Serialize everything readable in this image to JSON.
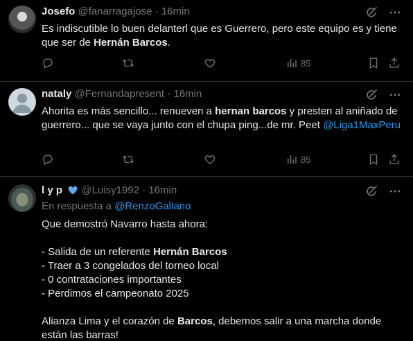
{
  "tweets": [
    {
      "name": "Josefo",
      "handle": "@fanarragajose",
      "time": "16min",
      "text_pre": "Es indiscutible lo buen delanterl que es Guerrero, pero este equipo es y tiene que ser de ",
      "text_bold": "Hernán Barcos",
      "text_post": ".",
      "views": "85"
    },
    {
      "name": "nataly",
      "handle": "@Fernandapresent",
      "time": "16min",
      "text_pre": "Ahorita es más sencillo... renueven a ",
      "text_bold": "hernan barcos",
      "text_post": " y presten al aniñado de guerrero... que se vaya junto con el chupa ping...de mr. Peet ",
      "mention": "@Liga1MaxPeru",
      "views": "85"
    },
    {
      "name": "l y p",
      "handle": "@Luisy1992",
      "time": "16min",
      "reply_prefix": "En respuesta a ",
      "reply_to": "@RenzoGaliano",
      "line1": "Que demostró Navarro hasta ahora:",
      "item1_pre": "- Salida de un referente ",
      "item1_bold": "Hernán Barcos",
      "item2": "- Traer a 3 congelados del torneo local",
      "item3": "- 0 contrataciones importantes",
      "item4": "- Perdimos el campeonato 2025",
      "closing_pre": "Alianza Lima y el corazón de ",
      "closing_bold": "Barcos",
      "closing_post": ", debemos salir a una marcha donde están las barras!"
    }
  ],
  "colors": {
    "background": "#000000",
    "text": "#e7e9ea",
    "muted": "#71767b",
    "link": "#1d9bf0",
    "divider": "#2f3336"
  },
  "icons": [
    "grok-icon",
    "more-icon",
    "reply-icon",
    "retweet-icon",
    "like-icon",
    "views-icon",
    "bookmark-icon",
    "share-icon",
    "blue-heart-icon"
  ]
}
